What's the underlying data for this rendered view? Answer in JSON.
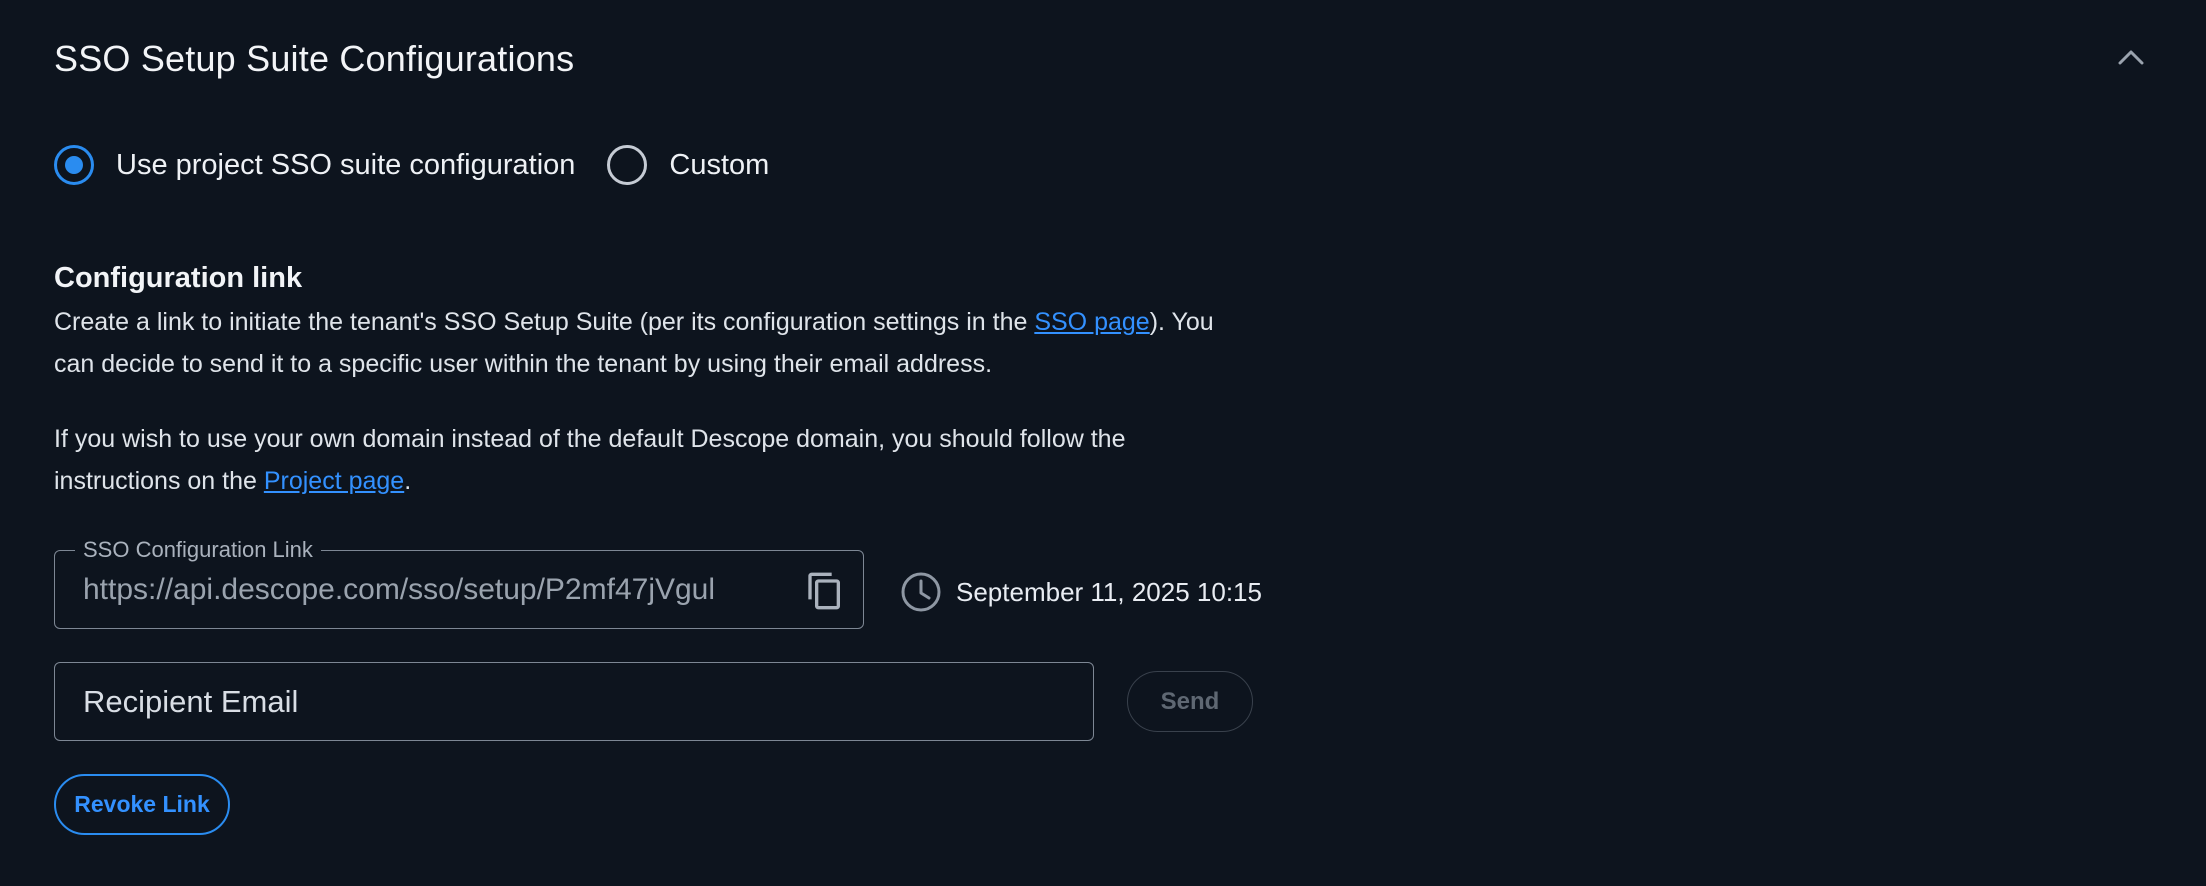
{
  "header": {
    "title": "SSO Setup Suite Configurations",
    "collapse_icon": "chevron-up-icon"
  },
  "radio": {
    "options": [
      {
        "label": "Use project SSO suite configuration",
        "checked": true
      },
      {
        "label": "Custom",
        "checked": false
      }
    ]
  },
  "config_link": {
    "heading": "Configuration link",
    "p1_before": "Create a link to initiate the tenant's SSO Setup Suite (per its configuration settings in the ",
    "p1_link": "SSO page",
    "p1_after": "). You can decide to send it to a specific user within the tenant by using their email address.",
    "p2_before": "If you wish to use your own domain instead of the default Descope domain, you should follow the instructions on the ",
    "p2_link": "Project page",
    "p2_after": ".",
    "field_label": "SSO Configuration Link",
    "field_value": "https://api.descope.com/sso/setup/P2mf47jVgul",
    "copy_icon": "copy-icon",
    "expiry_icon": "clock-icon",
    "expiry_text": "September 11, 2025 10:15"
  },
  "email": {
    "placeholder": "Recipient Email",
    "value": ""
  },
  "actions": {
    "send_label": "Send",
    "revoke_label": "Revoke Link"
  },
  "colors": {
    "background": "#0d141e",
    "accent": "#2a8cf0",
    "link": "#3391ff",
    "border": "#7d8794"
  }
}
